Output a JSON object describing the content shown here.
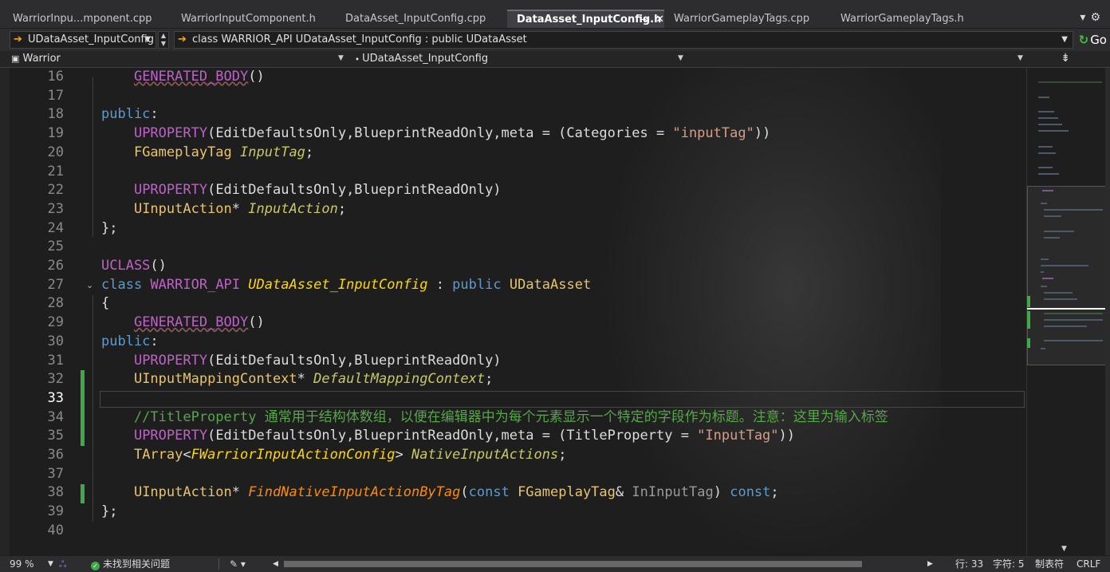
{
  "tabs": [
    {
      "label": "WarriorInpu...mponent.cpp",
      "active": false
    },
    {
      "label": "WarriorInputComponent.h",
      "active": false
    },
    {
      "label": "DataAsset_InputConfig.cpp",
      "active": false
    },
    {
      "label": "DataAsset_InputConfig.h",
      "active": true
    },
    {
      "label": "WarriorGameplayTags.cpp",
      "active": false
    },
    {
      "label": "WarriorGameplayTags.h",
      "active": false
    }
  ],
  "navbar": {
    "type_combo": "UDataAsset_InputConfig",
    "member_combo": "class WARRIOR_API UDataAsset_InputConfig : public UDataAsset",
    "go_label": "Go"
  },
  "scopebar": {
    "project": "Warrior",
    "scope": "UDataAsset_InputConfig",
    "member": ""
  },
  "editor": {
    "current_line": 33,
    "line_numbers": [
      "16",
      "17",
      "18",
      "19",
      "20",
      "21",
      "22",
      "23",
      "24",
      "25",
      "26",
      "27",
      "28",
      "29",
      "30",
      "31",
      "32",
      "33",
      "34",
      "35",
      "36",
      "37",
      "38",
      "39",
      "40"
    ],
    "lines": [
      "    GENERATED_BODY()",
      "",
      "public:",
      "    UPROPERTY(EditDefaultsOnly,BlueprintReadOnly,meta = (Categories = \"inputTag\"))",
      "    FGameplayTag InputTag;",
      "",
      "    UPROPERTY(EditDefaultsOnly,BlueprintReadOnly)",
      "    UInputAction* InputAction;",
      "};",
      "",
      "UCLASS()",
      "class WARRIOR_API UDataAsset_InputConfig : public UDataAsset",
      "{",
      "    GENERATED_BODY()",
      "public:",
      "    UPROPERTY(EditDefaultsOnly,BlueprintReadOnly)",
      "    UInputMappingContext* DefaultMappingContext;",
      "",
      "    //TitleProperty 通常用于结构体数组，以便在编辑器中为每个元素显示一个特定的字段作为标题。注意：这里为输入标签",
      "    UPROPERTY(EditDefaultsOnly,BlueprintReadOnly,meta = (TitleProperty = \"InputTag\"))",
      "    TArray<FWarriorInputActionConfig> NativeInputActions;",
      "",
      "    UInputAction* FindNativeInputActionByTag(const FGameplayTag& InInputTag) const;",
      "};",
      ""
    ]
  },
  "statusbar": {
    "zoom": "99 %",
    "issues": "未找到相关问题",
    "line": "行: 33",
    "char": "字符: 5",
    "indent": "制表符",
    "eol": "CRLF"
  },
  "colors": {
    "keyword": "#569cd6",
    "macro": "#bd63c5",
    "comment": "#57a64a",
    "string": "#d69d85",
    "function": "#ff8c00",
    "change_marker": "#3fa94b"
  },
  "icons": [
    "arrow-right-icon",
    "go-icon",
    "project-icon",
    "split-icon",
    "close-icon",
    "pin-icon",
    "ok-icon",
    "brush-icon"
  ]
}
